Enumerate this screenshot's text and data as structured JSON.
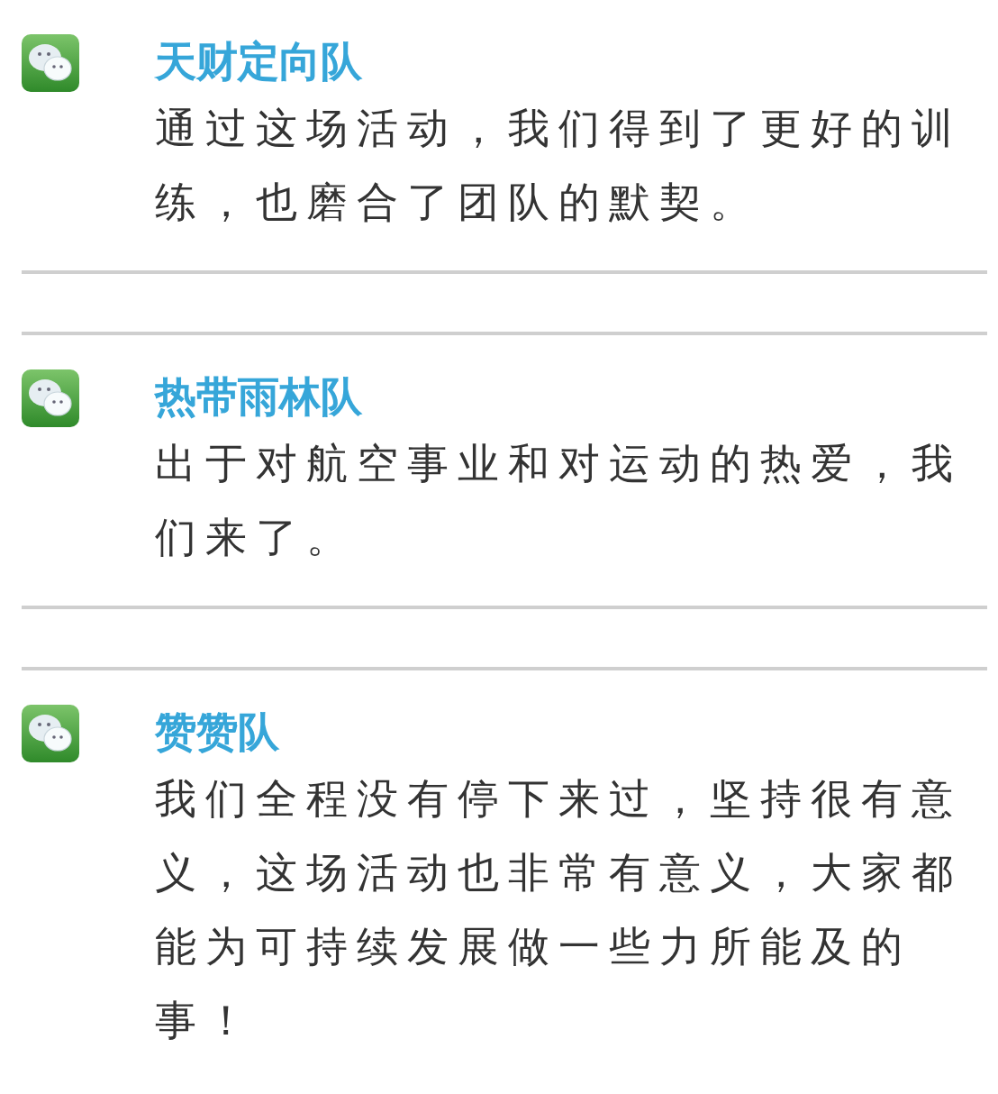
{
  "posts": [
    {
      "team": "天财定向队",
      "message": "通过这场活动，我们得到了更好的训练，也磨合了团队的默契。"
    },
    {
      "team": "热带雨林队",
      "message": "出于对航空事业和对运动的热爱，我们来了。"
    },
    {
      "team": "赞赞队",
      "message": "我们全程没有停下来过，坚持很有意义，这场活动也非常有意义，大家都能为可持续发展做一些力所能及的事！"
    }
  ]
}
